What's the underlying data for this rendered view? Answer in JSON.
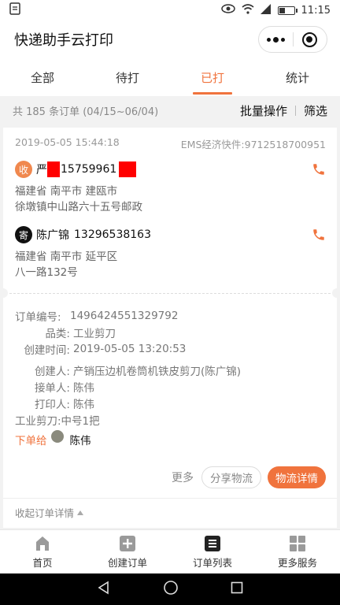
{
  "status_bar": {
    "time": "11:15"
  },
  "app": {
    "title": "快递助手云打印"
  },
  "tabs": [
    {
      "label": "全部",
      "active": false
    },
    {
      "label": "待打",
      "active": false
    },
    {
      "label": "已打",
      "active": true
    },
    {
      "label": "统计",
      "active": false
    }
  ],
  "summary": {
    "count_text": "共 185 条订单 (04/15~06/04)",
    "batch_label": "批量操作",
    "filter_label": "筛选"
  },
  "order": {
    "datetime": "2019-05-05 15:44:18",
    "tracking": "EMS经济快件:9712518700951",
    "receiver": {
      "badge": "收",
      "name": "严",
      "phone": "15759961",
      "address_line1": "福建省 南平市 建瓯市",
      "address_line2": "徐墩镇中山路六十五号邮政"
    },
    "sender": {
      "badge": "寄",
      "name": "陈广锦",
      "phone": "13296538163",
      "address_line1": "福建省 南平市 延平区",
      "address_line2": "八一路132号"
    },
    "details": [
      {
        "key": "订单编号:",
        "value": "1496424551329792"
      },
      {
        "key": "品类:",
        "value": "工业剪刀"
      },
      {
        "key": "创建时间:",
        "value": "2019-05-05 13:20:53"
      }
    ],
    "people": [
      {
        "key": "创建人:",
        "value": "产销压边机卷筒机铁皮剪刀(陈广锦)"
      },
      {
        "key": "接单人:",
        "value": "陈伟"
      },
      {
        "key": "打印人:",
        "value": "陈伟"
      }
    ],
    "goods": "工业剪刀:中号1把",
    "dispatch_label": "下单给",
    "dispatch_to": "陈伟",
    "more_label": "更多",
    "share_label": "分享物流",
    "logistics_label": "物流详情",
    "collapse_label": "收起订单详情"
  },
  "colors": {
    "accent": "#f0733d",
    "redaction": "#ff0000"
  },
  "bottom_nav": [
    {
      "label": "首页",
      "icon": "home-icon"
    },
    {
      "label": "创建订单",
      "icon": "plus-square-icon"
    },
    {
      "label": "订单列表",
      "icon": "list-icon"
    },
    {
      "label": "更多服务",
      "icon": "grid-icon"
    }
  ]
}
